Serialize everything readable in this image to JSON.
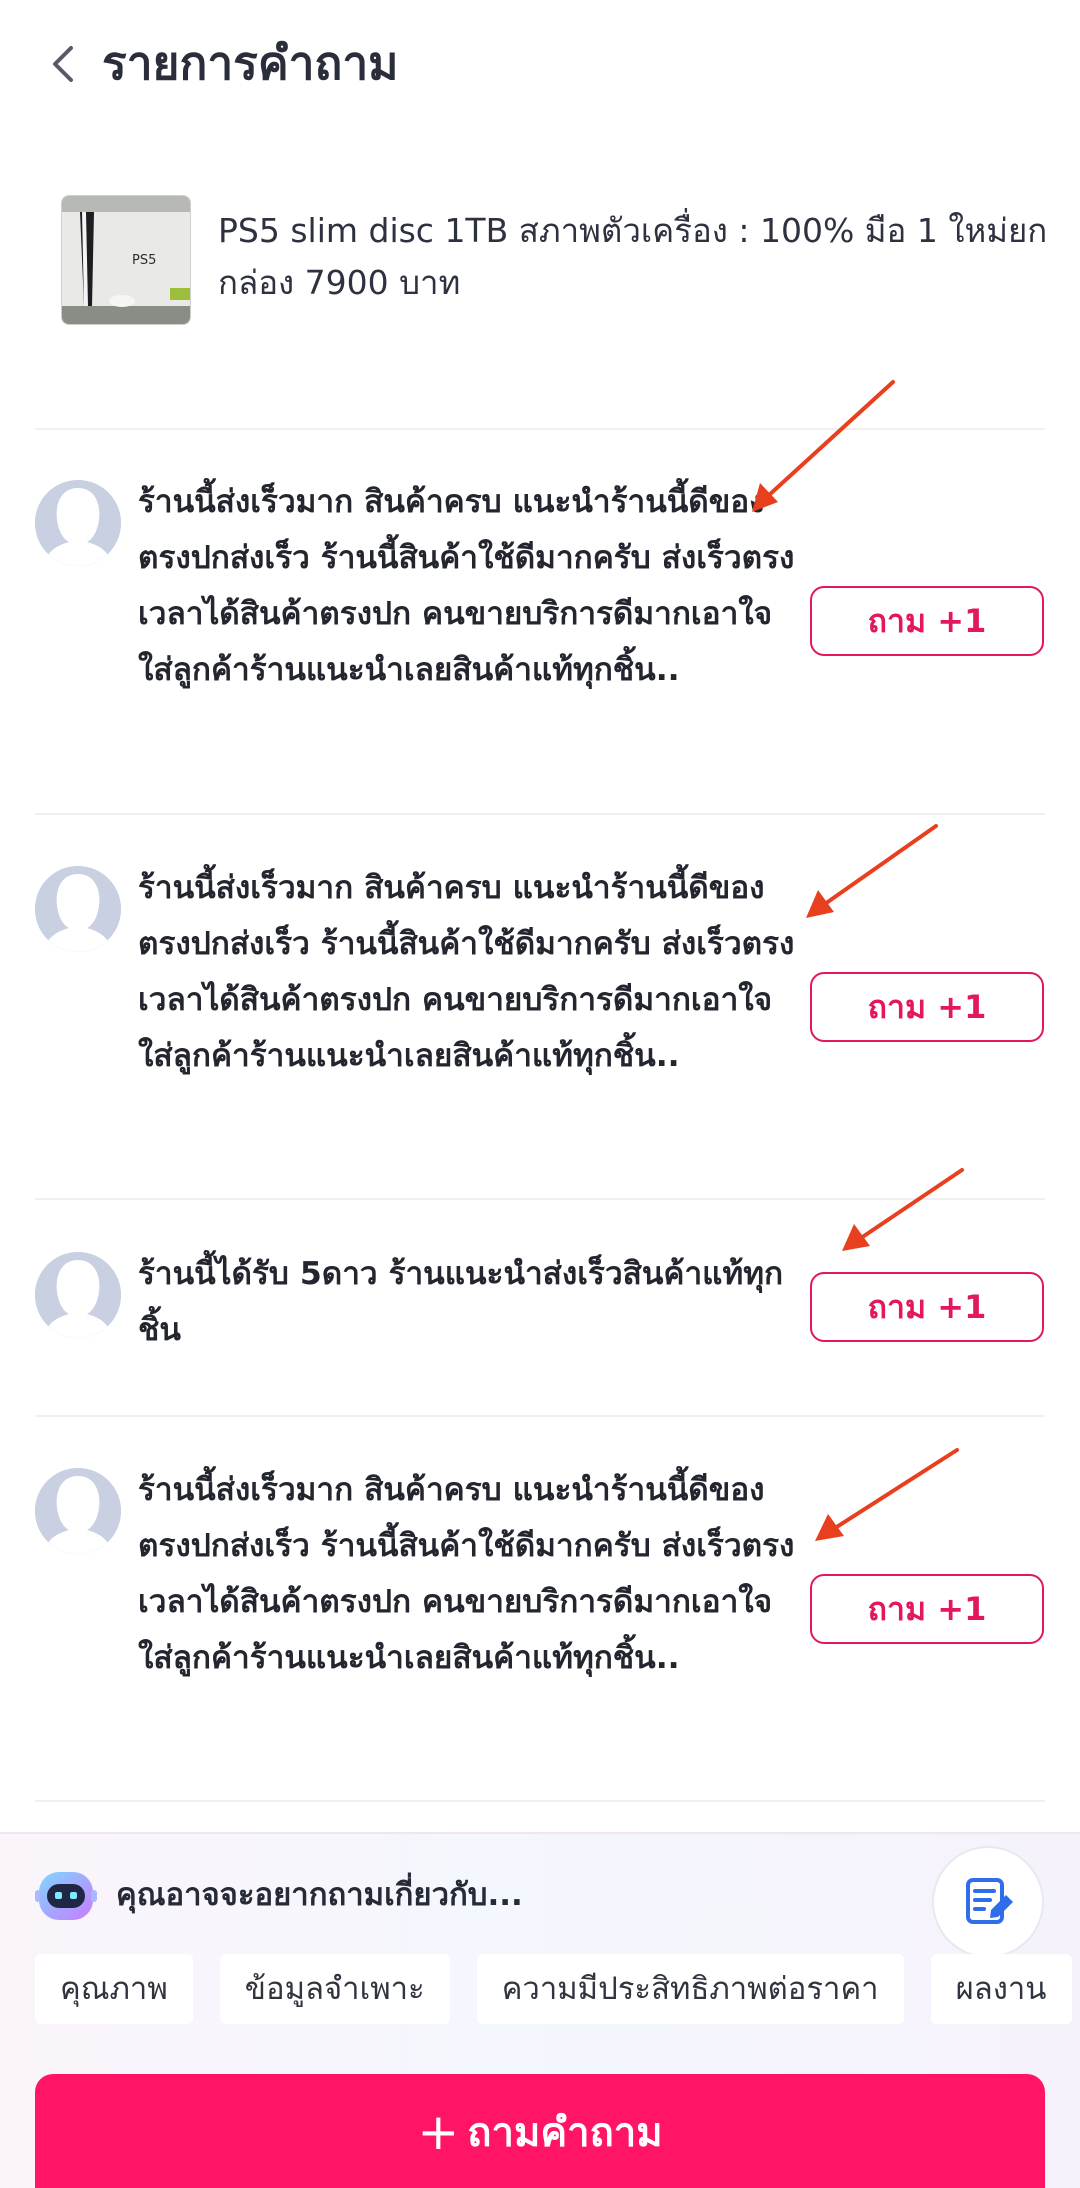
{
  "header": {
    "title": "รายการคำถาม",
    "back_icon": "chevron-left-icon"
  },
  "product": {
    "title": "PS5 slim disc 1TB สภาพตัวเครื่อง : 100% มือ 1 ใหม่ยกกล่อง 7900 บาท",
    "thumb_text": "PS5"
  },
  "questions": [
    {
      "text": "ร้านนี้ส่งเร็วมาก สินค้าครบ แนะนำร้านนี้ดีของตรงปกส่งเร็ว ร้านนี้สินค้าใช้ดีมากครับ ส่งเร็วตรงเวลาได้สินค้าตรงปก คนขายบริการดีมากเอาใจใส่ลูกค้าร้านแนะนำเลยสินค้าแท้ทุกชิ้น..",
      "button": "ถาม +1"
    },
    {
      "text": "ร้านนี้ส่งเร็วมาก สินค้าครบ แนะนำร้านนี้ดีของตรงปกส่งเร็ว ร้านนี้สินค้าใช้ดีมากครับ ส่งเร็วตรงเวลาได้สินค้าตรงปก คนขายบริการดีมากเอาใจใส่ลูกค้าร้านแนะนำเลยสินค้าแท้ทุกชิ้น..",
      "button": "ถาม +1"
    },
    {
      "text": "ร้านนี้ได้รับ 5ดาว ร้านแนะนำส่งเร็วสินค้าแท้ทุกชิ้น",
      "button": "ถาม +1"
    },
    {
      "text": "ร้านนี้ส่งเร็วมาก สินค้าครบ แนะนำร้านนี้ดีของตรงปกส่งเร็ว ร้านนี้สินค้าใช้ดีมากครับ ส่งเร็วตรงเวลาได้สินค้าตรงปก คนขายบริการดีมากเอาใจใส่ลูกค้าร้านแนะนำเลยสินค้าแท้ทุกชิ้น..",
      "button": "ถาม +1"
    }
  ],
  "suggestions": {
    "title": "คุณอาจจะอยากถามเกี่ยวกับ...",
    "chips": [
      "คุณภาพ",
      "ข้อมูลจำเพาะ",
      "ความมีประสิทธิภาพต่อราคา",
      "ผลงาน"
    ],
    "icons": {
      "bot": "robot-icon",
      "edit": "edit-note-icon"
    }
  },
  "ask_button": {
    "label": "ถามคำถาม",
    "icon": "plus-icon"
  },
  "colors": {
    "accent": "#ff1466",
    "button_text": "#e2175f",
    "annotation_arrow": "#e8401f",
    "avatar": "#c8d0e2"
  }
}
